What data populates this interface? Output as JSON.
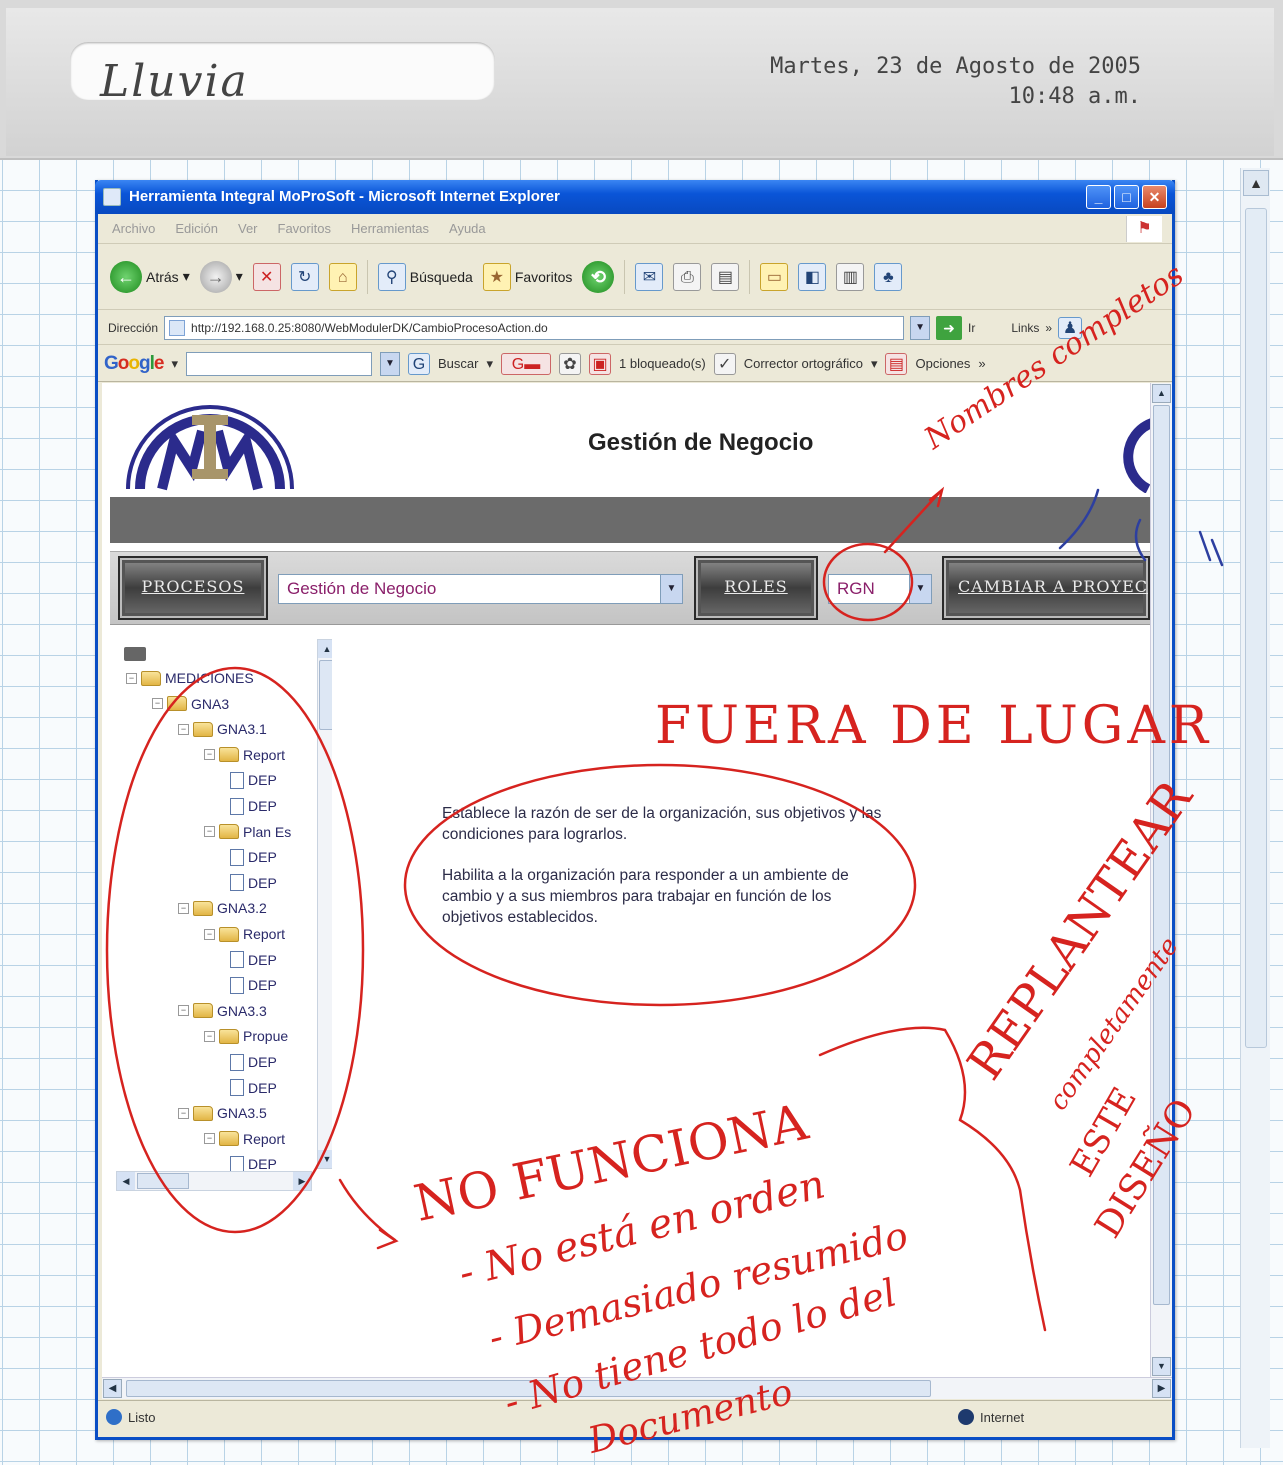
{
  "header": {
    "weather": "Lluvia",
    "date": "Martes, 23 de Agosto de 2005",
    "time": "10:48 a.m."
  },
  "window": {
    "title": "Herramienta Integral MoProSoft - Microsoft Internet Explorer",
    "menu": [
      "Archivo",
      "Edición",
      "Ver",
      "Favoritos",
      "Herramientas",
      "Ayuda"
    ],
    "toolbar": {
      "back": "Atrás",
      "search": "Búsqueda",
      "favorites": "Favoritos"
    },
    "address": {
      "label": "Dirección",
      "url": "http://192.168.0.25:8080/WebModulerDK/CambioProcesoAction.do",
      "go": "Ir",
      "links": "Links"
    },
    "googlebar": {
      "search": "Buscar",
      "blocked": "1 bloqueado(s)",
      "spell": "Corrector ortográfico",
      "options": "Opciones"
    },
    "status": {
      "left": "Listo",
      "zone": "Internet"
    }
  },
  "page": {
    "title": "Gestión de Negocio",
    "buttons": {
      "procesos": "PROCESOS",
      "roles": "ROLES",
      "cambiar": "CAMBIAR A PROYECTO"
    },
    "process_select": "Gestión de Negocio",
    "role_select": "RGN",
    "tree": [
      {
        "label": "MEDICIONES",
        "level": 0,
        "type": "folder",
        "expanded": true
      },
      {
        "label": "GNA3",
        "level": 1,
        "type": "folder",
        "expanded": true
      },
      {
        "label": "GNA3.1",
        "level": 2,
        "type": "folder",
        "expanded": true
      },
      {
        "label": "Report",
        "level": 3,
        "type": "folder",
        "expanded": true
      },
      {
        "label": "DEP",
        "level": 4,
        "type": "doc"
      },
      {
        "label": "DEP",
        "level": 4,
        "type": "doc"
      },
      {
        "label": "Plan Es",
        "level": 3,
        "type": "folder",
        "expanded": true
      },
      {
        "label": "DEP",
        "level": 4,
        "type": "doc"
      },
      {
        "label": "DEP",
        "level": 4,
        "type": "doc"
      },
      {
        "label": "GNA3.2",
        "level": 2,
        "type": "folder",
        "expanded": true
      },
      {
        "label": "Report",
        "level": 3,
        "type": "folder",
        "expanded": true
      },
      {
        "label": "DEP",
        "level": 4,
        "type": "doc"
      },
      {
        "label": "DEP",
        "level": 4,
        "type": "doc"
      },
      {
        "label": "GNA3.3",
        "level": 2,
        "type": "folder",
        "expanded": true
      },
      {
        "label": "Propue",
        "level": 3,
        "type": "folder",
        "expanded": true
      },
      {
        "label": "DEP",
        "level": 4,
        "type": "doc"
      },
      {
        "label": "DEP",
        "level": 4,
        "type": "doc"
      },
      {
        "label": "GNA3.5",
        "level": 2,
        "type": "folder",
        "expanded": true
      },
      {
        "label": "Report",
        "level": 3,
        "type": "folder",
        "expanded": true
      },
      {
        "label": "DEP",
        "level": 4,
        "type": "doc"
      }
    ],
    "description": [
      "Establece la razón de ser de la organización, sus objetivos y las condiciones para lograrlos.",
      "Habilita a la organización para responder a un ambiente de cambio y a sus miembros para trabajar en función de los objetivos establecidos."
    ]
  },
  "annotations": {
    "nombres": "Nombres completos",
    "fuera": "FUERA DE LUGAR",
    "replantear": "REPLANTEAR",
    "completamente": "completamente",
    "este": "ESTE",
    "diseno": "DISEÑO",
    "no_funciona": "NO FUNCIONA",
    "bullet1": "- No está en orden",
    "bullet2": "- Demasiado resumido",
    "bullet3": "- No tiene todo lo del",
    "bullet4": "Documento"
  },
  "colors": {
    "titlebar": "#0a55d8",
    "ink": "#d6231f",
    "grey_band": "#6b6b6b",
    "select_text": "#8a1f6a"
  }
}
